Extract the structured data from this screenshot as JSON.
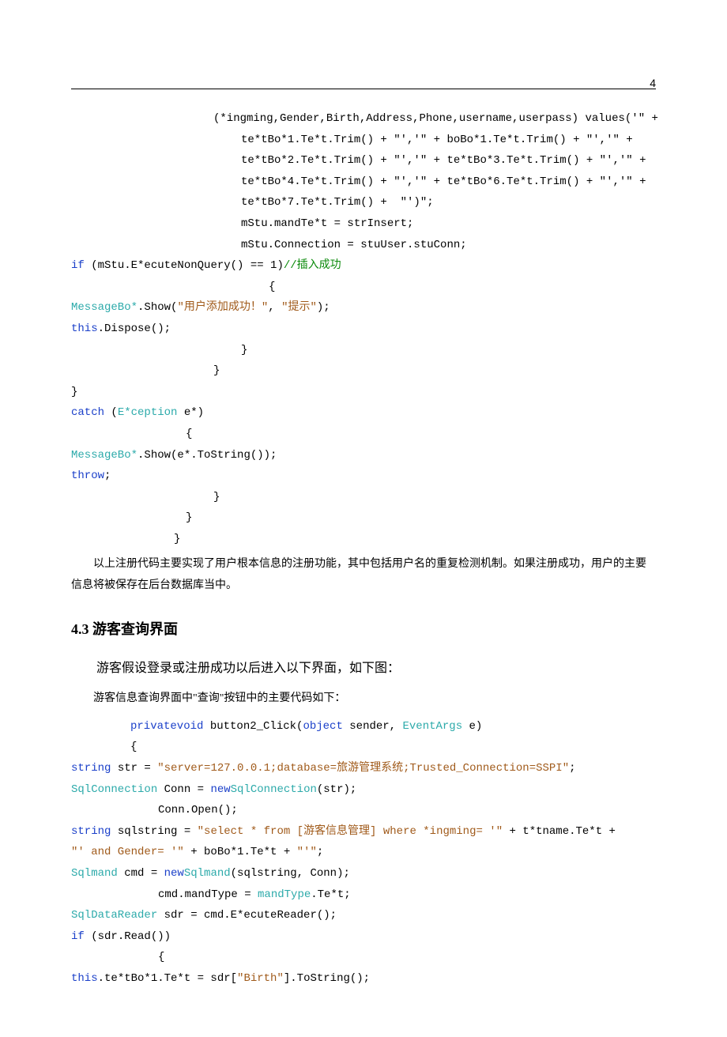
{
  "page_number": "4",
  "code_block1": {
    "l1": "(*ingming,Gender,Birth,Address,Phone,username,userpass) values('\" +",
    "l2": "te*tBo*1.Te*t.Trim() + \"','\" + boBo*1.Te*t.Trim() + \"','\" +",
    "l3": "te*tBo*2.Te*t.Trim() + \"','\" + te*tBo*3.Te*t.Trim() + \"','\" +",
    "l4": "te*tBo*4.Te*t.Trim() + \"','\" + te*tBo*6.Te*t.Trim() + \"','\" +",
    "l5": "te*tBo*7.Te*t.Trim() +  \"')\";",
    "l6": "mStu.mandTe*t = strInsert;",
    "l7": "mStu.Connection = stuUser.stuConn;",
    "l8a": "if",
    "l8b": " (mStu.E*ecuteNonQuery() == 1)",
    "l8c": "//插入成功",
    "l9": "{",
    "l10a": "MessageBo*",
    "l10b": ".Show(",
    "l10c": "\"用户添加成功！\"",
    "l10d": ", ",
    "l10e": "\"提示\"",
    "l10f": ");",
    "l11a": "this",
    "l11b": ".Dispose();",
    "l12": "}",
    "l13": "}",
    "l14": "}",
    "l15a": "catch",
    "l15b": " (",
    "l15c": "E*ception",
    "l15d": " e*)",
    "l16": "{",
    "l17a": "MessageBo*",
    "l17b": ".Show(e*.ToString());",
    "l18": "throw",
    "l18b": ";",
    "l19": "}",
    "l20": "}",
    "l21": "}"
  },
  "para1": "以上注册代码主要实现了用户根本信息的注册功能，其中包括用户名的重复检测机制。如果注册成功，用户的主要信息将被保存在后台数据库当中。",
  "section_title": "4.3 游客查询界面",
  "intro1": "游客假设登录或注册成功以后进入以下界面，如下图：",
  "intro2": "游客信息查询界面中\"查询\"按钮中的主要代码如下：",
  "code_block2": {
    "l1a": "privatevoid",
    "l1b": " button2_Click(",
    "l1c": "object",
    "l1d": " sender, ",
    "l1e": "EventArgs",
    "l1f": " e)",
    "l2": "{",
    "l3a": "string",
    "l3b": " str = ",
    "l3c": "\"server=127.0.0.1;database=旅游管理系统;Trusted_Connection=SSPI\"",
    "l3d": ";",
    "l4a": "SqlConnection",
    "l4b": " Conn = ",
    "l4c": "new",
    "l4d": "SqlConnection",
    "l4e": "(str);",
    "l5": "Conn.Open();",
    "l6a": "string",
    "l6b": " sqlstring = ",
    "l6c": "\"select * from [游客信息管理] where *ingming= '\"",
    "l6d": " + t*tname.Te*t + ",
    "l7a": "\"' and Gender= '\"",
    "l7b": " + boBo*1.Te*t + ",
    "l7c": "\"'\"",
    "l7d": ";",
    "l8a": "Sqlmand",
    "l8b": " cmd = ",
    "l8c": "new",
    "l8d": "Sqlmand",
    "l8e": "(sqlstring, Conn);",
    "l9a": "cmd.mandType = ",
    "l9b": "mandType",
    "l9c": ".Te*t;",
    "l10a": "SqlDataReader",
    "l10b": " sdr = cmd.E*ecuteReader();",
    "l11a": "if",
    "l11b": " (sdr.Read())",
    "l12": "{",
    "l13a": "this",
    "l13b": ".te*tBo*1.Te*t = sdr[",
    "l13c": "\"Birth\"",
    "l13d": "].ToString();"
  }
}
